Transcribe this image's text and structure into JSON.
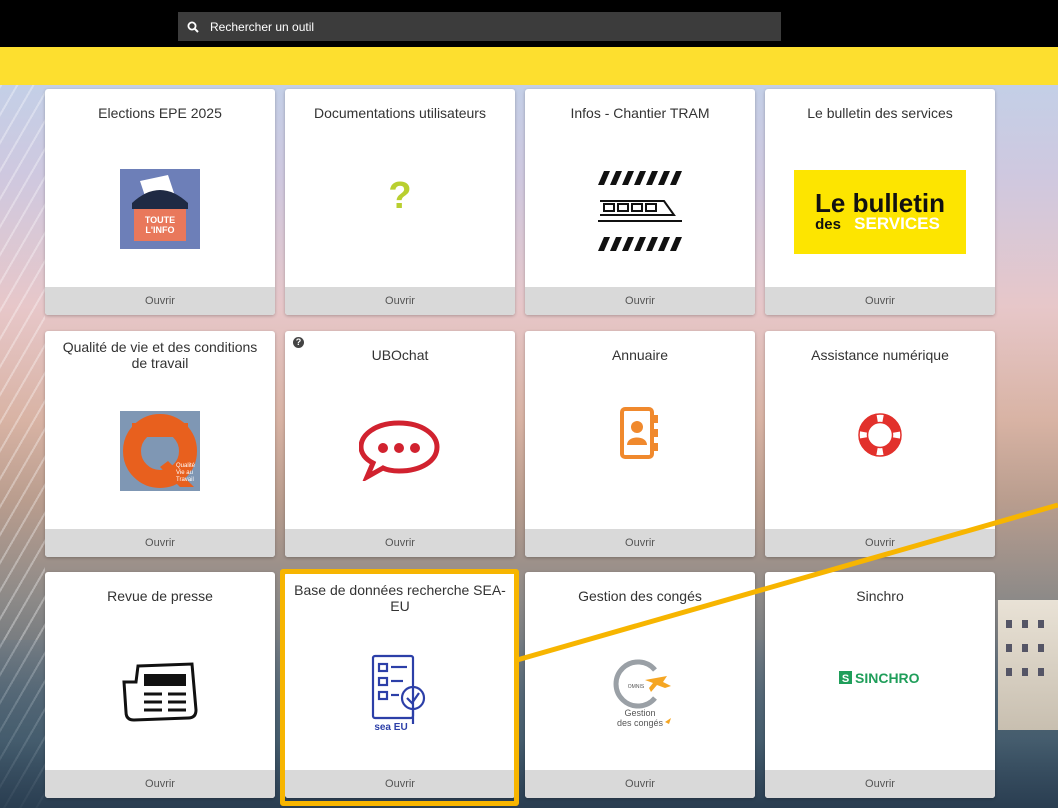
{
  "search": {
    "placeholder": "Rechercher un outil",
    "icon": "search-icon"
  },
  "colors": {
    "topbar": "#000000",
    "search_bg": "#3c3c3c",
    "yellow_band": "#fddf2f",
    "highlight": "#f7b500",
    "card_footer": "#d9d9d9"
  },
  "open_label": "Ouvrir",
  "tiles": [
    {
      "title": "Elections EPE 2025",
      "logo_text": "TOUTE\nL'INFO",
      "icon": "ballot-box-icon"
    },
    {
      "title": "Documentations utilisateurs",
      "icon": "question-mark-icon"
    },
    {
      "title": "Infos - Chantier TRAM",
      "icon": "tram-construction-icon"
    },
    {
      "title": "Le bulletin des services",
      "logo_text1": "Le bulletin",
      "logo_text2": "des",
      "logo_text3": "SERVICES",
      "icon": "bulletin-logo"
    },
    {
      "title": "Qualité de vie et des conditions de travail",
      "logo_text": "Qualité\nVie au\nTravail",
      "icon": "qvt-logo"
    },
    {
      "title": "UBOchat",
      "icon": "rocket-chat-icon",
      "help": "?"
    },
    {
      "title": "Annuaire",
      "icon": "address-book-icon"
    },
    {
      "title": "Assistance numérique",
      "icon": "lifebuoy-icon"
    },
    {
      "title": "Revue de presse",
      "icon": "newspaper-icon"
    },
    {
      "title": "Base de données recherche SEA-EU",
      "logo_text": "sea EU",
      "icon": "checklist-search-icon"
    },
    {
      "title": "Gestion des congés",
      "logo_text1": "Gestion",
      "logo_text2": "des congés",
      "logo_small": "OMNIS",
      "icon": "leave-management-logo"
    },
    {
      "title": "Sinchro",
      "logo_text": "SINCHRO",
      "icon": "sinchro-logo"
    }
  ]
}
